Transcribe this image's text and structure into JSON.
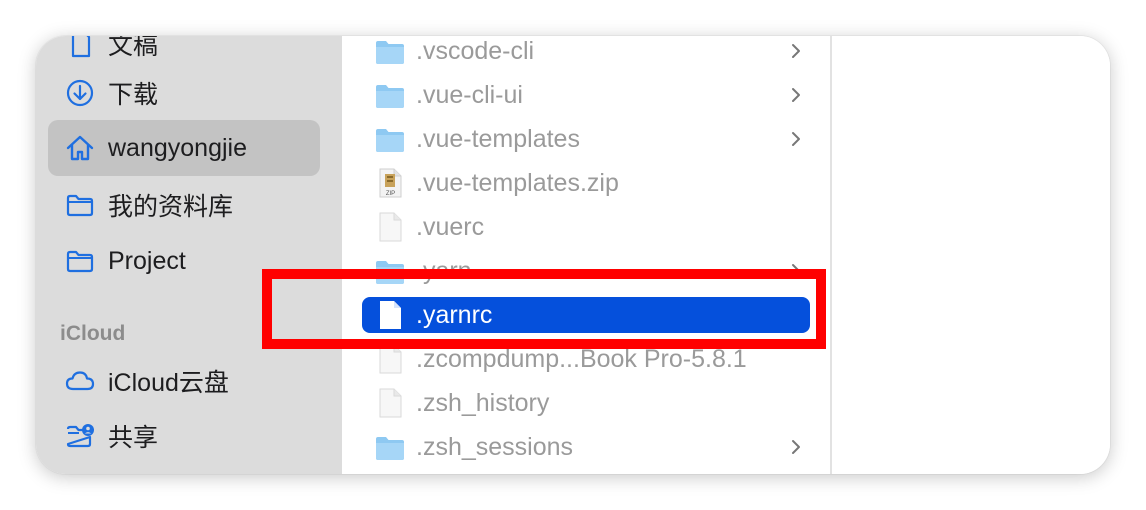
{
  "sidebar": {
    "items": [
      {
        "label": "文稿",
        "icon": "document-icon"
      },
      {
        "label": "下载",
        "icon": "download-icon"
      },
      {
        "label": "wangyongjie",
        "icon": "home-icon",
        "selected": true
      },
      {
        "label": "我的资料库",
        "icon": "folder-icon"
      },
      {
        "label": "Project",
        "icon": "folder-icon"
      }
    ],
    "icloud_section": "iCloud",
    "icloud_items": [
      {
        "label": "iCloud云盘",
        "icon": "cloud-icon"
      },
      {
        "label": "共享",
        "icon": "shared-folder-icon"
      }
    ]
  },
  "files": [
    {
      "name": ".vscode-cli",
      "kind": "folder",
      "has_children": true
    },
    {
      "name": ".vue-cli-ui",
      "kind": "folder",
      "has_children": true
    },
    {
      "name": ".vue-templates",
      "kind": "folder",
      "has_children": true
    },
    {
      "name": ".vue-templates.zip",
      "kind": "zip",
      "has_children": false
    },
    {
      "name": ".vuerc",
      "kind": "file",
      "has_children": false
    },
    {
      "name": ".yarn",
      "kind": "folder",
      "has_children": true
    },
    {
      "name": ".yarnrc",
      "kind": "file",
      "has_children": false,
      "selected": true
    },
    {
      "name": ".zcompdump...Book Pro-5.8.1",
      "kind": "file",
      "has_children": false
    },
    {
      "name": ".zsh_history",
      "kind": "file",
      "has_children": false
    },
    {
      "name": ".zsh_sessions",
      "kind": "folder",
      "has_children": true
    }
  ],
  "colors": {
    "accent": "#0550dc",
    "sidebar_bg": "#dcdcdc",
    "sidebar_icon": "#1f6fe0",
    "highlight_box": "#ff0000",
    "folder": "#8ec9f2"
  }
}
